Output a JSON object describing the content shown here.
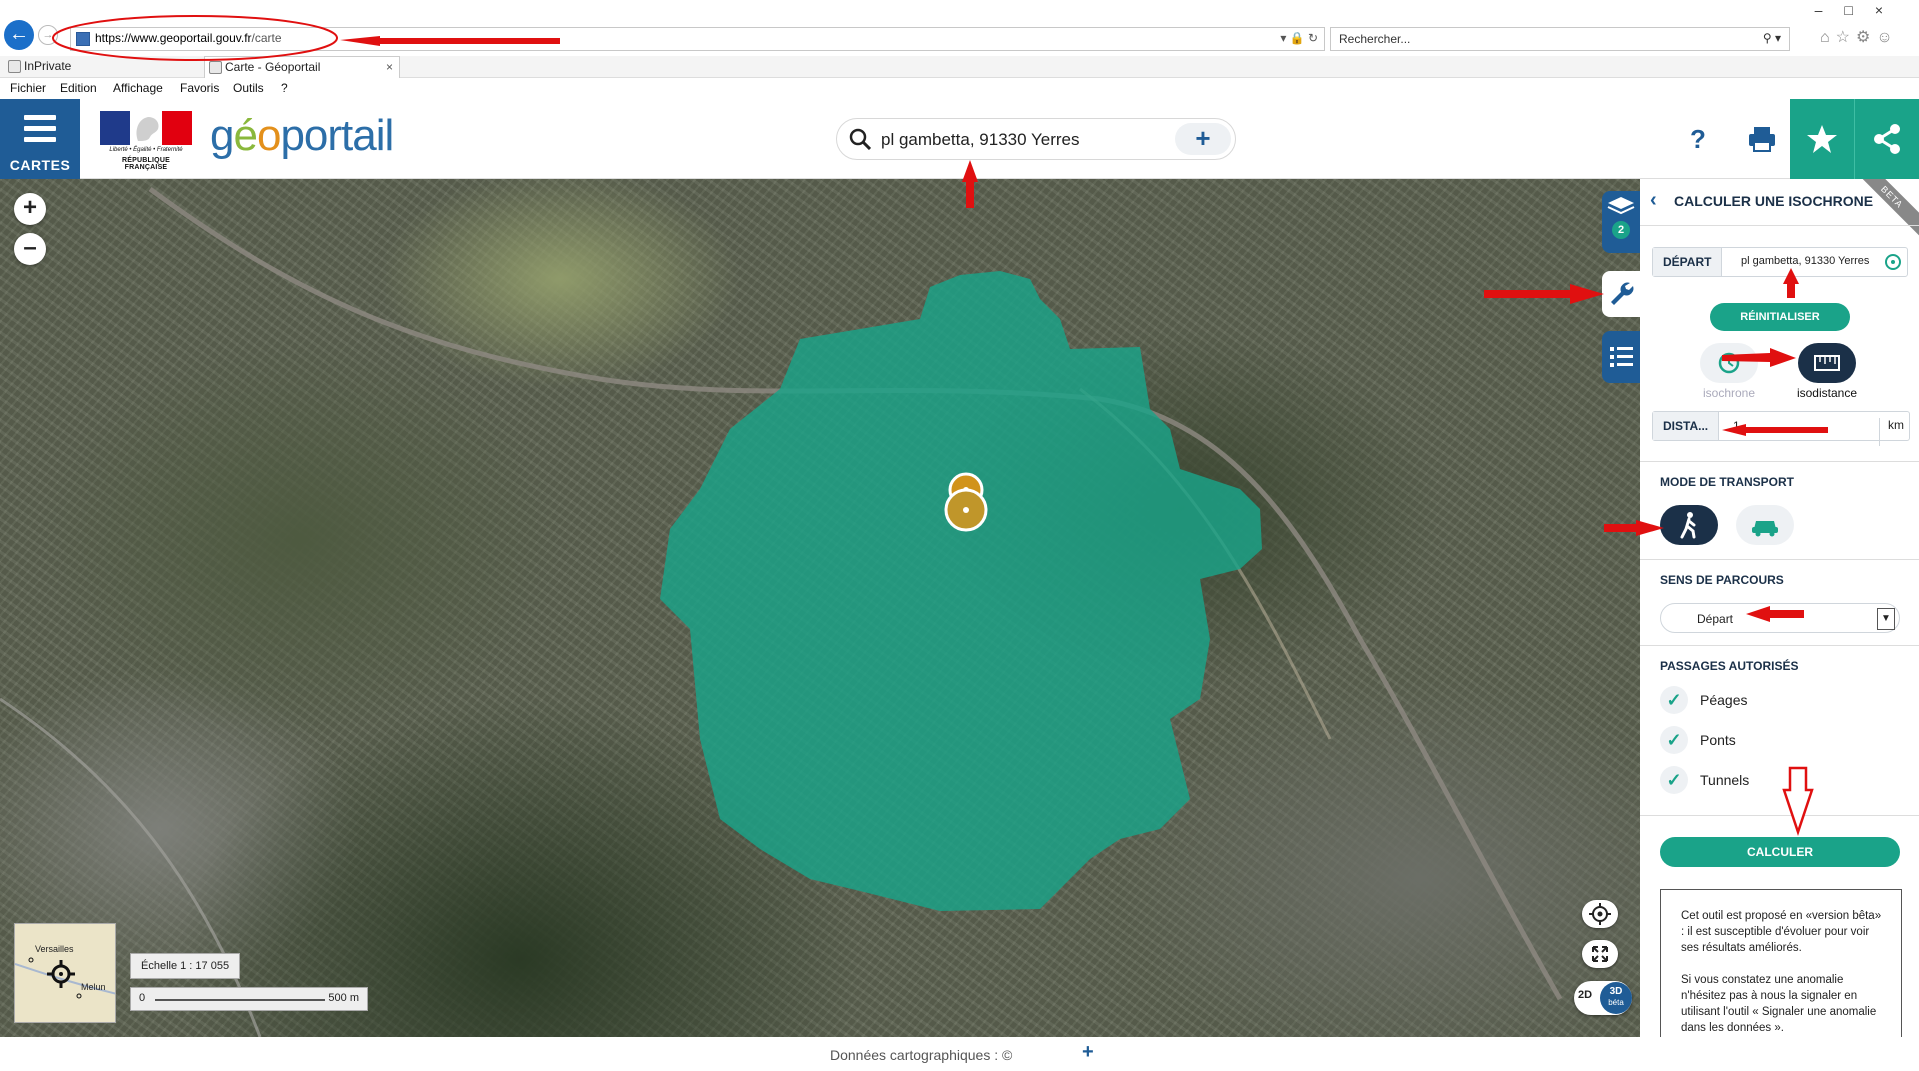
{
  "browser": {
    "url_host": "https://www.geoportail.gouv.fr",
    "url_path": "/carte",
    "search_placeholder": "Rechercher...",
    "tabs": [
      {
        "label": "InPrivate"
      },
      {
        "label": "Carte - Géoportail"
      }
    ],
    "menu": [
      "Fichier",
      "Edition",
      "Affichage",
      "Favoris",
      "Outils",
      "?"
    ]
  },
  "header": {
    "cartes_label": "CARTES",
    "rf_motto": "Liberté • Égalité • Fraternité",
    "rf_name": "RÉPUBLIQUE FRANÇAISE",
    "logo": {
      "part1": "g",
      "part2": "é",
      "part3": "o",
      "part4": "portail"
    },
    "search_value": "pl gambetta, 91330 Yerres",
    "help_label": "?"
  },
  "map": {
    "layer_count": "2",
    "minimap_labels": [
      "Versailles",
      "Melun"
    ],
    "scale_label": "Échelle 1 : 17 055",
    "scale_start": "0",
    "scale_end": "500 m",
    "btn_2d": "2D",
    "btn_3d": "3D",
    "btn_3d_sub": "béta",
    "isochrone_color": "#1aa389"
  },
  "panel": {
    "beta": "BETA",
    "title": "CALCULER UNE ISOCHRONE",
    "depart_label": "DÉPART",
    "depart_value": "pl gambetta, 91330 Yerres",
    "reset_label": "RÉINITIALISER",
    "mode_isochrone": "isochrone",
    "mode_isodistance": "isodistance",
    "distance_label": "DISTA...",
    "distance_value": "1",
    "distance_unit": "km",
    "transport_title": "MODE DE TRANSPORT",
    "sens_title": "SENS DE PARCOURS",
    "sens_value": "Départ",
    "passages_title": "PASSAGES AUTORISÉS",
    "passages": [
      "Péages",
      "Ponts",
      "Tunnels"
    ],
    "calc_label": "CALCULER",
    "info_p1": "Cet outil est proposé en «version bêta» : il est susceptible d'évoluer pour voir ses résultats améliorés.",
    "info_p2": "Si vous constatez une anomalie n'hésitez pas à nous la signaler en utilisant l'outil « Signaler une anomalie dans les données »."
  },
  "footer": {
    "credits": "Données cartographiques : ©",
    "plus": "+"
  },
  "colors": {
    "primary_blue": "#1f5c96",
    "accent_green": "#1aa389",
    "annotation_red": "#e01010"
  }
}
